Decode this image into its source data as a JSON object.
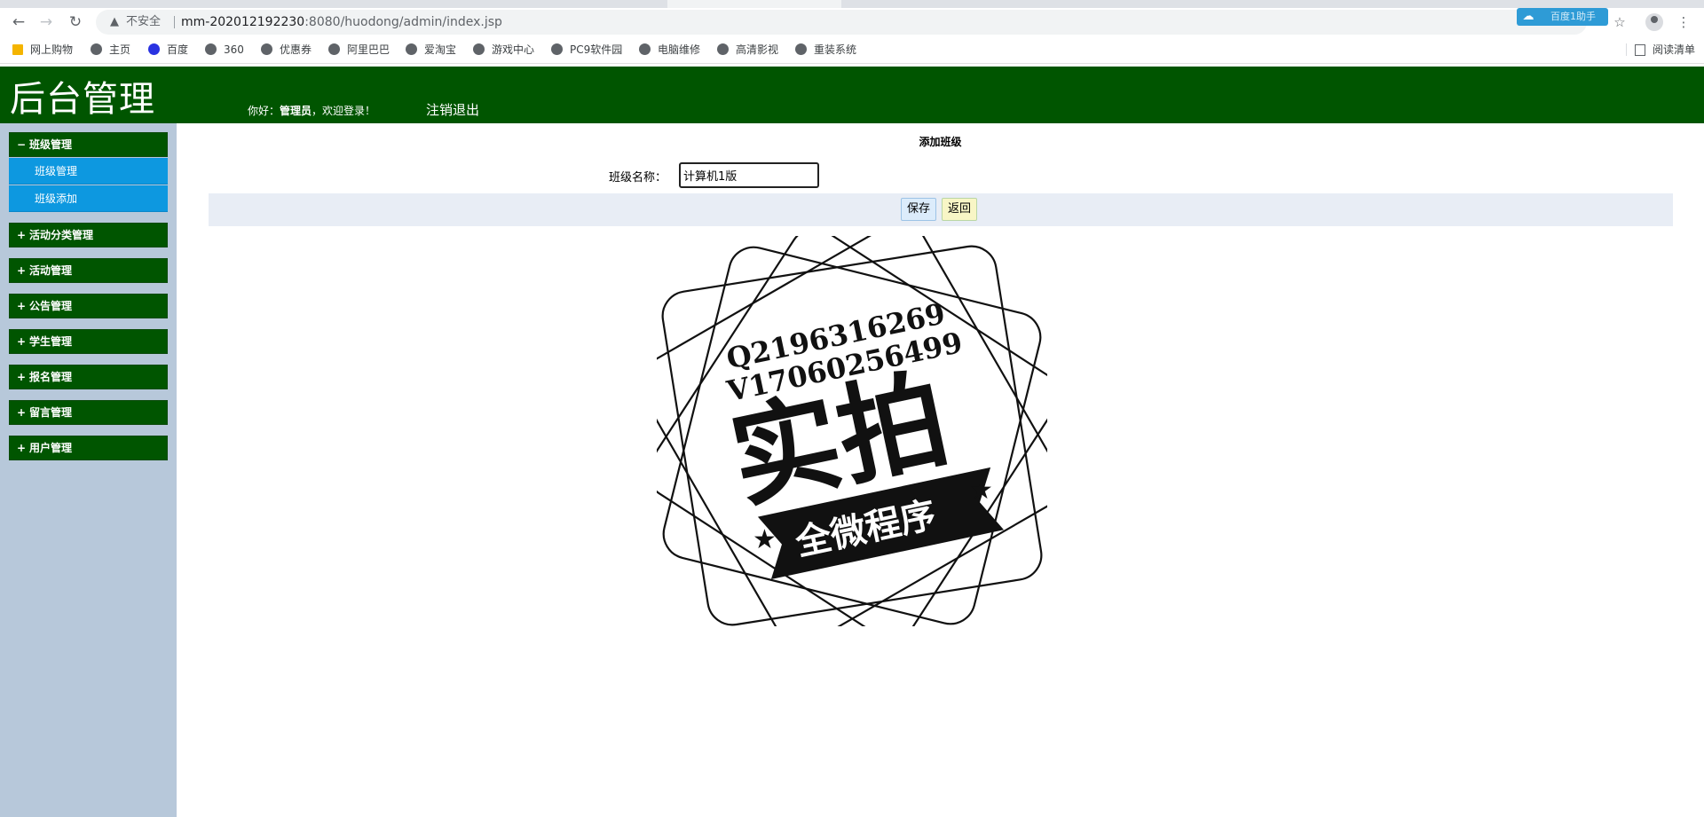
{
  "browser": {
    "security_text": "不安全",
    "url_host": "mm-202012192230",
    "url_rest": ":8080/huodong/admin/index.jsp",
    "extension_label": "百度1助手",
    "bookmarks": [
      "网上购物",
      "主页",
      "百度",
      "360",
      "优惠券",
      "阿里巴巴",
      "爱淘宝",
      "游戏中心",
      "PC9软件园",
      "电脑维修",
      "高清影视",
      "重装系统"
    ],
    "reading_list": "阅读清单"
  },
  "header": {
    "title": "后台管理",
    "greeting_prefix": "你好：",
    "user_name": "管理员",
    "greeting_suffix": "，欢迎登录！",
    "logout": "注销退出"
  },
  "sidebar": {
    "groups": [
      {
        "sign": "−",
        "label": "班级管理"
      },
      {
        "sign": "+",
        "label": "活动分类管理"
      },
      {
        "sign": "+",
        "label": "活动管理"
      },
      {
        "sign": "+",
        "label": "公告管理"
      },
      {
        "sign": "+",
        "label": "学生管理"
      },
      {
        "sign": "+",
        "label": "报名管理"
      },
      {
        "sign": "+",
        "label": "留言管理"
      },
      {
        "sign": "+",
        "label": "用户管理"
      }
    ],
    "sub_items": [
      "班级管理",
      "班级添加"
    ]
  },
  "form": {
    "title": "添加班级",
    "field_label": "班级名称：",
    "field_value": "计算机1版",
    "save": "保存",
    "back": "返回"
  },
  "watermark": {
    "line1": "Q2196316269",
    "line2": "V17060256499",
    "big": "实拍",
    "ribbon": "全微程序"
  },
  "colors": {
    "header_bg": "#005500",
    "sidebar_bg": "#b7c8da",
    "submenu_bg": "#0d98e0",
    "button_bar_bg": "#e8edf5"
  }
}
